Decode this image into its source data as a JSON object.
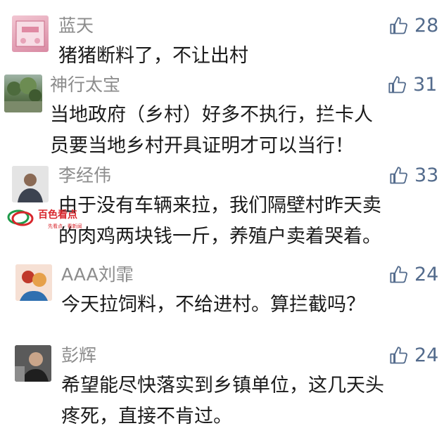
{
  "comments": [
    {
      "name": "蓝天",
      "likes": "28",
      "lines": [
        "猪猪断料了，不让出村"
      ]
    },
    {
      "name": "神行太宝",
      "likes": "31",
      "lines": [
        "当地政府（乡村）好多不执行，拦卡人",
        "员要当地乡村开具证明才可以当行！"
      ]
    },
    {
      "name": "李经伟",
      "likes": "33",
      "lines": [
        "由于没有车辆来拉，我们隔壁村昨天卖",
        "的肉鸡两块钱一斤，养殖户卖着哭着。"
      ]
    },
    {
      "name": "AAA刘霏",
      "likes": "24",
      "lines": [
        "今天拉饲料，不给进村。算拦截吗？"
      ]
    },
    {
      "name": "彭辉",
      "likes": "24",
      "lines": [
        "希望能尽快落实到乡镇单位，这几天头",
        "疼死，直接不肯过。"
      ]
    }
  ],
  "watermark": {
    "brand": "百色看点",
    "tagline": "先看点 · 看新闻"
  },
  "colors": {
    "name": "#8c8c8c",
    "text": "#1a1a1a",
    "like": "#536b8c",
    "brand_red": "#d8262c",
    "brand_green": "#1f9a4a"
  }
}
